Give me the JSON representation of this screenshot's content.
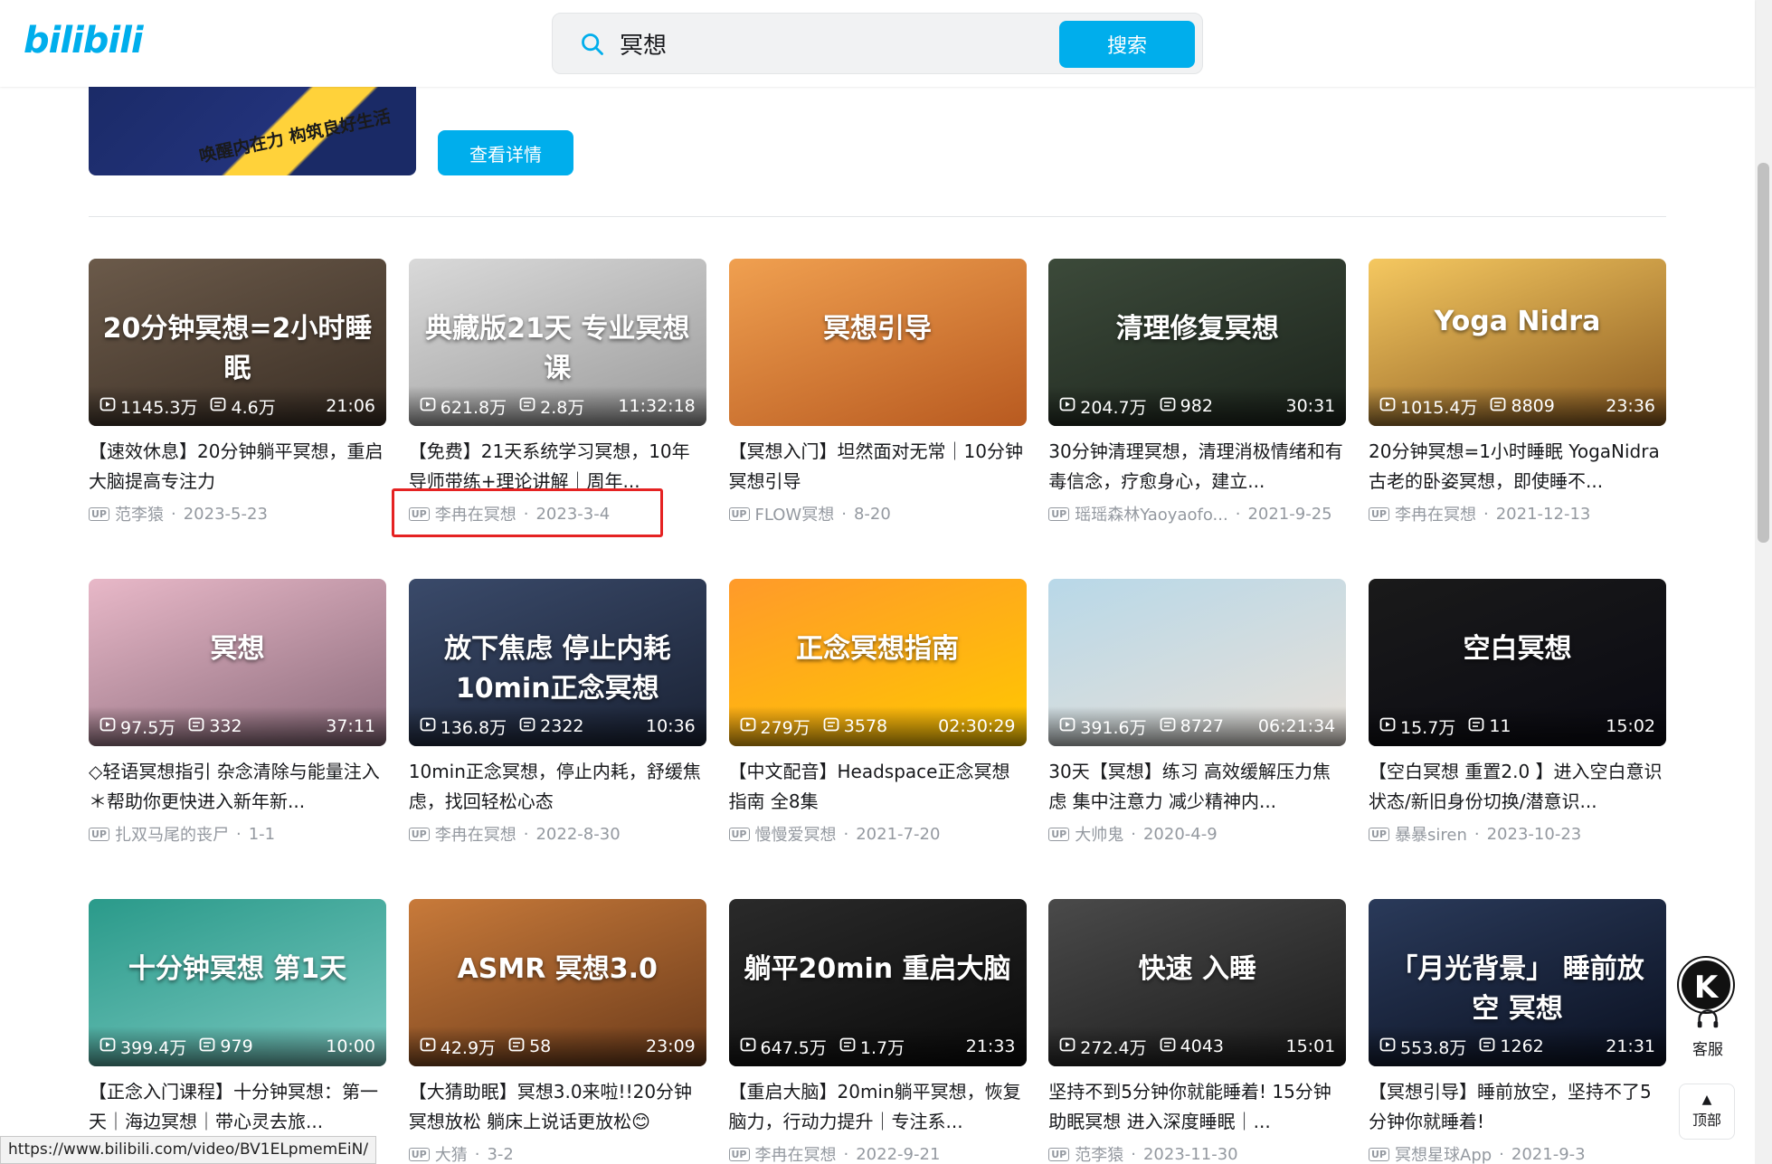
{
  "header": {
    "logo": "bilibili",
    "search_query": "冥想",
    "search_button": "搜索"
  },
  "banner": {
    "image_text": "唤醒内在力 构筑良好生活",
    "detail_button": "查看详情"
  },
  "videos": [
    {
      "thumb_text": "20分钟冥想=2小时睡眠",
      "views": "1145.3万",
      "danmaku": "4.6万",
      "duration": "21:06",
      "title": "【速效休息】20分钟躺平冥想，重启大脑提高专注力",
      "up": "范李猿",
      "date": "2023-5-23",
      "color1": "#6b5a4a",
      "color2": "#3a2e24"
    },
    {
      "thumb_text": "典藏版21天 专业冥想课",
      "views": "621.8万",
      "danmaku": "2.8万",
      "duration": "11:32:18",
      "title": "【免费】21天系统学习冥想，10年导师带练+理论讲解｜周年...",
      "up": "李冉在冥想",
      "date": "2023-3-4",
      "color1": "#d9d9d9",
      "color2": "#9a9a9a"
    },
    {
      "thumb_text": "冥想引导",
      "views": "",
      "danmaku": "",
      "duration": "",
      "title": "【冥想入门】坦然面对无常｜10分钟冥想引导",
      "up": "FLOW冥想",
      "date": "8-20",
      "color1": "#f0a050",
      "color2": "#b85a20"
    },
    {
      "thumb_text": "清理修复冥想",
      "views": "204.7万",
      "danmaku": "982",
      "duration": "30:31",
      "title": "30分钟清理冥想，清理消极情绪和有毒信念，疗愈身心，建立...",
      "up": "瑶瑶森林Yaoyaofo...",
      "date": "2021-9-25",
      "color1": "#3c4a3a",
      "color2": "#1c241c"
    },
    {
      "thumb_text": "Yoga Nidra",
      "views": "1015.4万",
      "danmaku": "8809",
      "duration": "23:36",
      "title": "20分钟冥想=1小时睡眠 YogaNidra古老的卧姿冥想，即使睡不...",
      "up": "李冉在冥想",
      "date": "2021-12-13",
      "color1": "#f5c860",
      "color2": "#8a5a20"
    },
    {
      "thumb_text": "冥想",
      "views": "97.5万",
      "danmaku": "332",
      "duration": "37:11",
      "title": "◇轻语冥想指引 杂念清除与能量注入＊帮助你更快进入新年新...",
      "up": "扎双马尾的丧尸",
      "date": "1-1",
      "color1": "#e8b8c8",
      "color2": "#8a6a7a"
    },
    {
      "thumb_text": "放下焦虑 停止内耗 10min正念冥想",
      "views": "136.8万",
      "danmaku": "2322",
      "duration": "10:36",
      "title": "10min正念冥想，停止内耗，舒缓焦虑，找回轻松心态",
      "up": "李冉在冥想",
      "date": "2022-8-30",
      "color1": "#3a4a6a",
      "color2": "#1a2234"
    },
    {
      "thumb_text": "正念冥想指南",
      "views": "279万",
      "danmaku": "3578",
      "duration": "02:30:29",
      "title": "【中文配音】Headspace正念冥想指南 全8集",
      "up": "慢慢爱冥想",
      "date": "2021-7-20",
      "color1": "#ff9a2a",
      "color2": "#ffc800"
    },
    {
      "thumb_text": "",
      "views": "391.6万",
      "danmaku": "8727",
      "duration": "06:21:34",
      "title": "30天【冥想】练习 高效缓解压力焦虑 集中注意力 减少精神内...",
      "up": "大帅鬼",
      "date": "2020-4-9",
      "color1": "#b8d8e8",
      "color2": "#e8e0d8"
    },
    {
      "thumb_text": "空白冥想",
      "views": "15.7万",
      "danmaku": "11",
      "duration": "15:02",
      "title": "【空白冥想 重置2.0 】进入空白意识状态/新旧身份切换/潜意识...",
      "up": "暴暴siren",
      "date": "2023-10-23",
      "color1": "#1a1a1a",
      "color2": "#0a0a12"
    },
    {
      "thumb_text": "十分钟冥想 第1天",
      "views": "399.4万",
      "danmaku": "979",
      "duration": "10:00",
      "title": "【正念入门课程】十分钟冥想：第一天｜海边冥想｜带心灵去旅...",
      "up": "",
      "date": "",
      "color1": "#2a9a8a",
      "color2": "#7ac8c0"
    },
    {
      "thumb_text": "ASMR 冥想3.0",
      "views": "42.9万",
      "danmaku": "58",
      "duration": "23:09",
      "title": "【大猜助眠】冥想3.0来啦!!20分钟冥想放松 躺床上说话更放松😊",
      "up": "大猜",
      "date": "3-2",
      "color1": "#c87a3a",
      "color2": "#6a3a1a"
    },
    {
      "thumb_text": "躺平20min 重启大脑",
      "views": "647.5万",
      "danmaku": "1.7万",
      "duration": "21:33",
      "title": "【重启大脑】20min躺平冥想，恢复脑力，行动力提升｜专注系...",
      "up": "李冉在冥想",
      "date": "2022-9-21",
      "color1": "#2a2a2a",
      "color2": "#0a0a0a"
    },
    {
      "thumb_text": "快速 入睡",
      "views": "272.4万",
      "danmaku": "4043",
      "duration": "15:01",
      "title": "坚持不到5分钟你就能睡着! 15分钟助眠冥想 进入深度睡眠｜...",
      "up": "范李猿",
      "date": "2023-11-30",
      "color1": "#4a4a4a",
      "color2": "#1a1a1a"
    },
    {
      "thumb_text": "「月光背景」 睡前放空 冥想",
      "views": "553.8万",
      "danmaku": "1262",
      "duration": "21:31",
      "title": "【冥想引导】睡前放空，坚持不了5分钟你就睡着!",
      "up": "冥想星球App",
      "date": "2021-9-3",
      "color1": "#2a3a5a",
      "color2": "#0a1020"
    }
  ],
  "widgets": {
    "service_label": "客服",
    "top_label": "顶部",
    "status_url": "https://www.bilibili.com/video/BV1ELpmemEiN/"
  }
}
